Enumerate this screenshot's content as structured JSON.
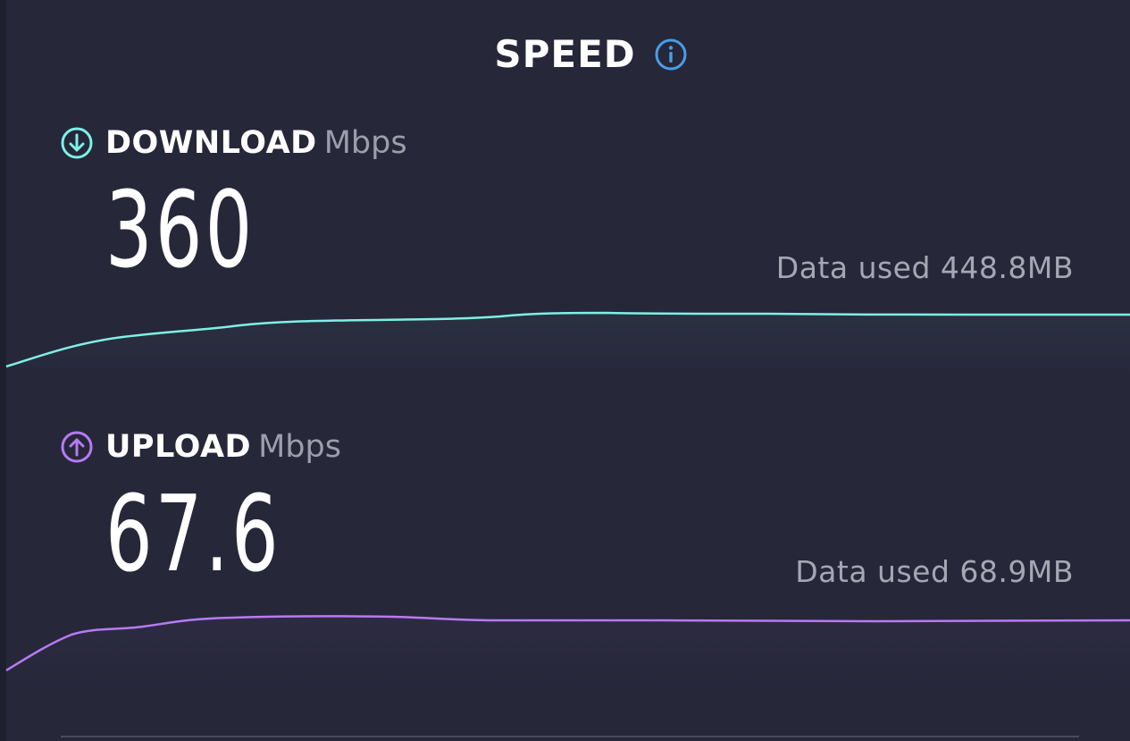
{
  "header": {
    "title": "SPEED",
    "info_icon": "info-icon"
  },
  "download": {
    "label": "DOWNLOAD",
    "unit": "Mbps",
    "value": "360",
    "data_used": "Data used 448.8MB",
    "icon": "arrow-down-circle-icon",
    "color": "#7ff0e6"
  },
  "upload": {
    "label": "UPLOAD",
    "unit": "Mbps",
    "value": "67.6",
    "data_used": "Data used 68.9MB",
    "icon": "arrow-up-circle-icon",
    "color": "#b77af5"
  },
  "colors": {
    "background": "#262739",
    "info_accent": "#4a9de8"
  }
}
